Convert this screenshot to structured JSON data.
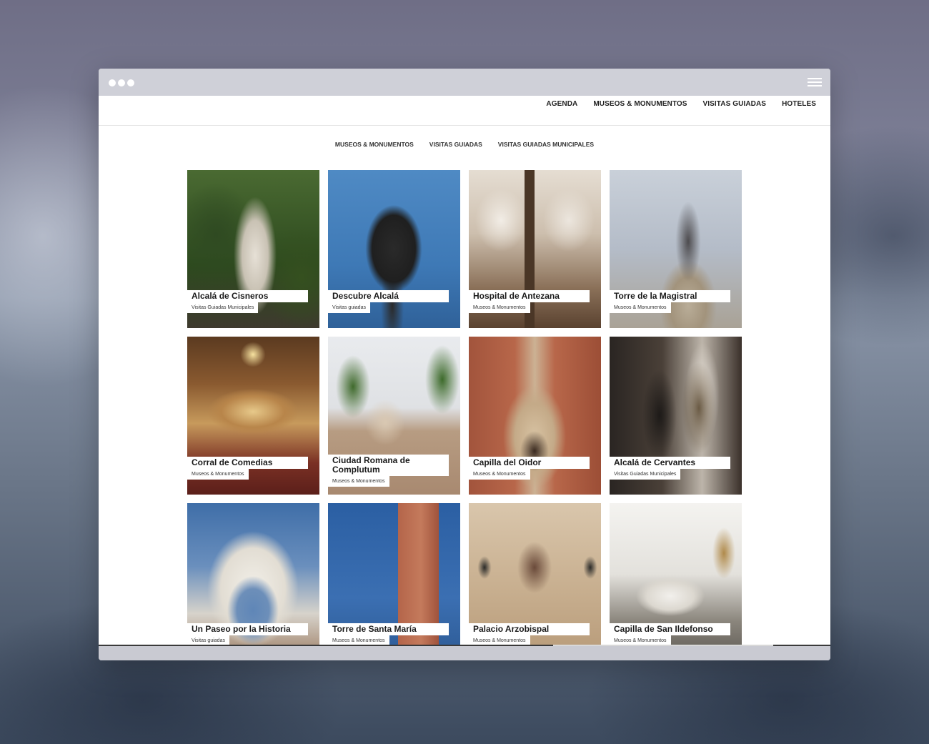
{
  "nav": [
    "AGENDA",
    "MUSEOS & MONUMENTOS",
    "VISITAS GUIADAS",
    "HOTELES"
  ],
  "subnav": [
    "MUSEOS & MONUMENTOS",
    "VISITAS GUIADAS",
    "VISITAS GUIADAS MUNICIPALES"
  ],
  "cards": [
    {
      "title": "Alcalá de Cisneros",
      "category": "Visitas Guiadas Municipales"
    },
    {
      "title": "Descubre Alcalá",
      "category": "Visitas guiadas"
    },
    {
      "title": "Hospital de Antezana",
      "category": "Museos & Monumentos"
    },
    {
      "title": "Torre de la Magistral",
      "category": "Museos & Monumentos"
    },
    {
      "title": "Corral de Comedias",
      "category": "Museos & Monumentos"
    },
    {
      "title": "Ciudad Romana de Complutum",
      "category": "Museos & Monumentos"
    },
    {
      "title": "Capilla del Oidor",
      "category": "Museos & Monumentos"
    },
    {
      "title": "Alcalá de Cervantes",
      "category": "Visitas Guiadas Municipales"
    },
    {
      "title": "Un Paseo por la Historia",
      "category": "Visitas guiadas"
    },
    {
      "title": "Torre de Santa María",
      "category": "Museos & Monumentos"
    },
    {
      "title": "Palacio Arzobispal",
      "category": "Museos & Monumentos"
    },
    {
      "title": "Capilla de San Ildefonso",
      "category": "Museos & Monumentos"
    }
  ]
}
